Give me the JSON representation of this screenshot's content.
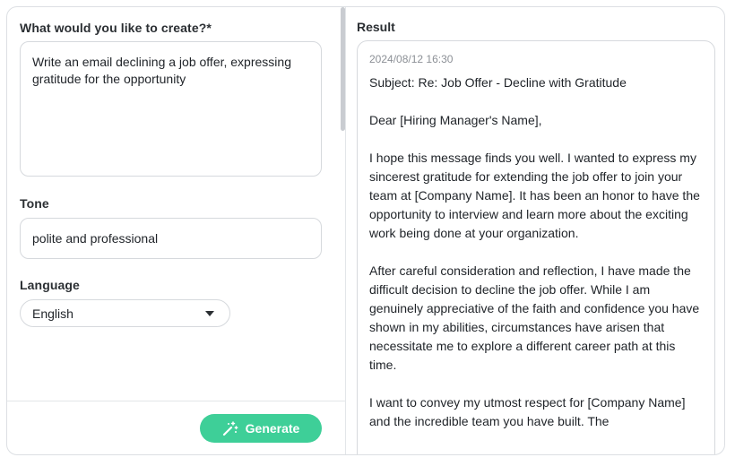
{
  "form": {
    "prompt_label": "What would you like to create?*",
    "prompt_value": "Write an email declining a job offer, expressing gratitude for the opportunity",
    "tone_label": "Tone",
    "tone_value": "polite and professional",
    "language_label": "Language",
    "language_value": "English",
    "generate_label": "Generate"
  },
  "result": {
    "label": "Result",
    "timestamp": "2024/08/12 16:30",
    "paragraphs": [
      "Subject: Re: Job Offer - Decline with Gratitude",
      "Dear [Hiring Manager's Name],",
      "I hope this message finds you well. I wanted to express my sincerest gratitude for extending the job offer to join your team at [Company Name]. It has been an honor to have the opportunity to interview and learn more about the exciting work being done at your organization.",
      "After careful consideration and reflection, I have made the difficult decision to decline the job offer. While I am genuinely appreciative of the faith and confidence you have shown in my abilities, circumstances have arisen that necessitate me to explore a different career path at this time.",
      "I want to convey my utmost respect for [Company Name] and the incredible team you have built. The"
    ]
  },
  "colors": {
    "accent": "#3ecf98",
    "border": "#d6d9dd",
    "muted_text": "#8c9096"
  },
  "icons": {
    "generate": "magic-wand-icon",
    "dropdown": "caret-down-icon"
  }
}
